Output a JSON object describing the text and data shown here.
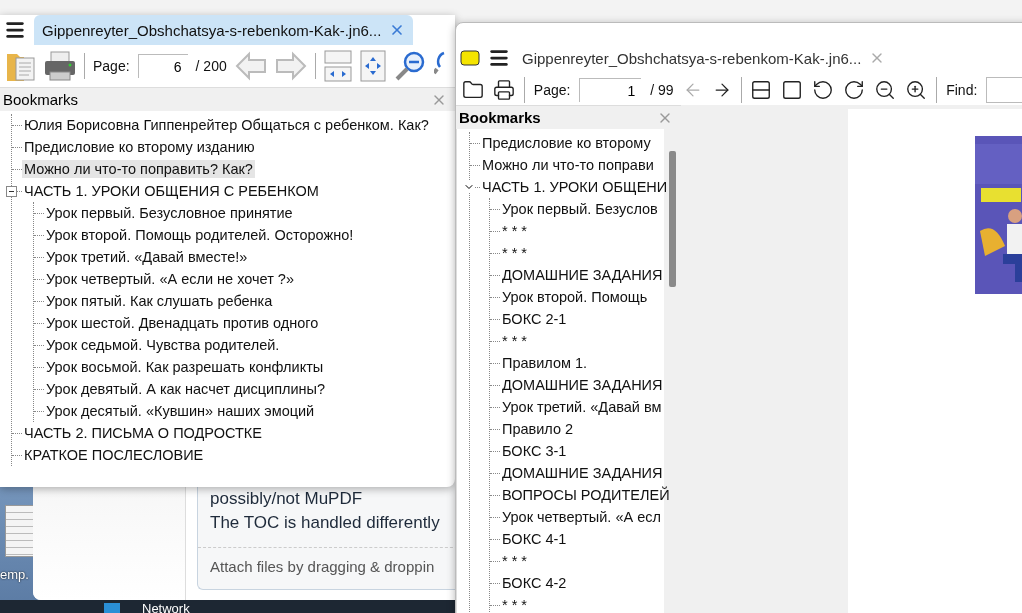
{
  "background_app": {
    "lines": [
      "possibly/not MuPDF",
      "The TOC is handled differently"
    ],
    "attach_hint": "Attach files by dragging & droppin"
  },
  "desktop": {
    "file_label": "emp.",
    "taskbar_label": "Network"
  },
  "left_window": {
    "tab": {
      "title": "Gippenreyter_Obshchatsya-s-rebenkom-Kak-.jn6...",
      "selected": true
    },
    "toolbar": {
      "page_label": "Page:",
      "page_value": "6",
      "page_total": "/ 200"
    },
    "bookmarks": {
      "title": "Bookmarks",
      "items": [
        {
          "label": "Юлия Борисовна Гиппенрейтер Общаться с ребенком. Как?",
          "selected": false
        },
        {
          "label": "Предисловие ко второму изданию",
          "selected": false
        },
        {
          "label": "Можно ли что-то поправить? Как?",
          "selected": true
        },
        {
          "label": "ЧАСТЬ 1. УРОКИ ОБЩЕНИЯ С РЕБЕНКОМ",
          "selected": false,
          "expanded": true,
          "children": [
            {
              "label": "Урок первый. Безусловное принятие",
              "selected": false
            },
            {
              "label": "Урок второй. Помощь родителей. Осторожно!",
              "selected": false
            },
            {
              "label": "Урок третий. «Давай вместе!»",
              "selected": false
            },
            {
              "label": "Урок четвертый. «А если не хочет ?»",
              "selected": false
            },
            {
              "label": "Урок пятый. Как слушать ребенка",
              "selected": false
            },
            {
              "label": "Урок шестой. Двенадцать против одного",
              "selected": false
            },
            {
              "label": "Урок седьмой. Чувства родителей.",
              "selected": false
            },
            {
              "label": "Урок восьмой. Как разрешать конфликты",
              "selected": false
            },
            {
              "label": "Урок девятый. А как насчет дисциплины?",
              "selected": false
            },
            {
              "label": "Урок десятый. «Кувшин» наших эмоций",
              "selected": false
            }
          ]
        },
        {
          "label": "ЧАСТЬ 2. ПИСЬМА О ПОДРОСТКЕ",
          "selected": false
        },
        {
          "label": "КРАТКОЕ ПОСЛЕСЛОВИЕ",
          "selected": false
        }
      ]
    }
  },
  "right_window": {
    "title": "Gippenreyter_Obshchatsya-s-rebenkom-Kak-.jn6...",
    "toolbar": {
      "page_label": "Page:",
      "page_value": "1",
      "page_total": "/ 99",
      "back_disabled": true,
      "forward_disabled": false,
      "find_label": "Find:"
    },
    "bookmarks": {
      "title": "Bookmarks",
      "items": [
        {
          "label": "Предисловие ко второму",
          "selected": false
        },
        {
          "label": "Можно ли что-то поправи",
          "selected": false
        },
        {
          "label": "ЧАСТЬ 1. УРОКИ ОБЩЕНИ",
          "selected": false,
          "expanded": true,
          "children": [
            {
              "label": "Урок первый. Безуслов",
              "selected": false
            },
            {
              "label": "* * *",
              "selected": false
            },
            {
              "label": "* * *",
              "selected": false
            },
            {
              "label": "ДОМАШНИЕ ЗАДАНИЯ",
              "selected": false
            },
            {
              "label": "Урок второй. Помощь",
              "selected": false
            },
            {
              "label": "БОКС 2-1",
              "selected": false
            },
            {
              "label": "* * *",
              "selected": false
            },
            {
              "label": "Правилом 1.",
              "selected": false
            },
            {
              "label": "ДОМАШНИЕ ЗАДАНИЯ",
              "selected": false
            },
            {
              "label": "Урок третий. «Давай вм",
              "selected": false
            },
            {
              "label": "Правило 2",
              "selected": false
            },
            {
              "label": "БОКС 3-1",
              "selected": false
            },
            {
              "label": "ДОМАШНИЕ ЗАДАНИЯ",
              "selected": false
            },
            {
              "label": "ВОПРОСЫ РОДИТЕЛЕЙ",
              "selected": false
            },
            {
              "label": "Урок четвертый. «А есл",
              "selected": false
            },
            {
              "label": "БОКС 4-1",
              "selected": false
            },
            {
              "label": "* * *",
              "selected": false
            },
            {
              "label": "БОКС 4-2",
              "selected": false
            },
            {
              "label": "* * *",
              "selected": false
            }
          ]
        }
      ]
    }
  }
}
